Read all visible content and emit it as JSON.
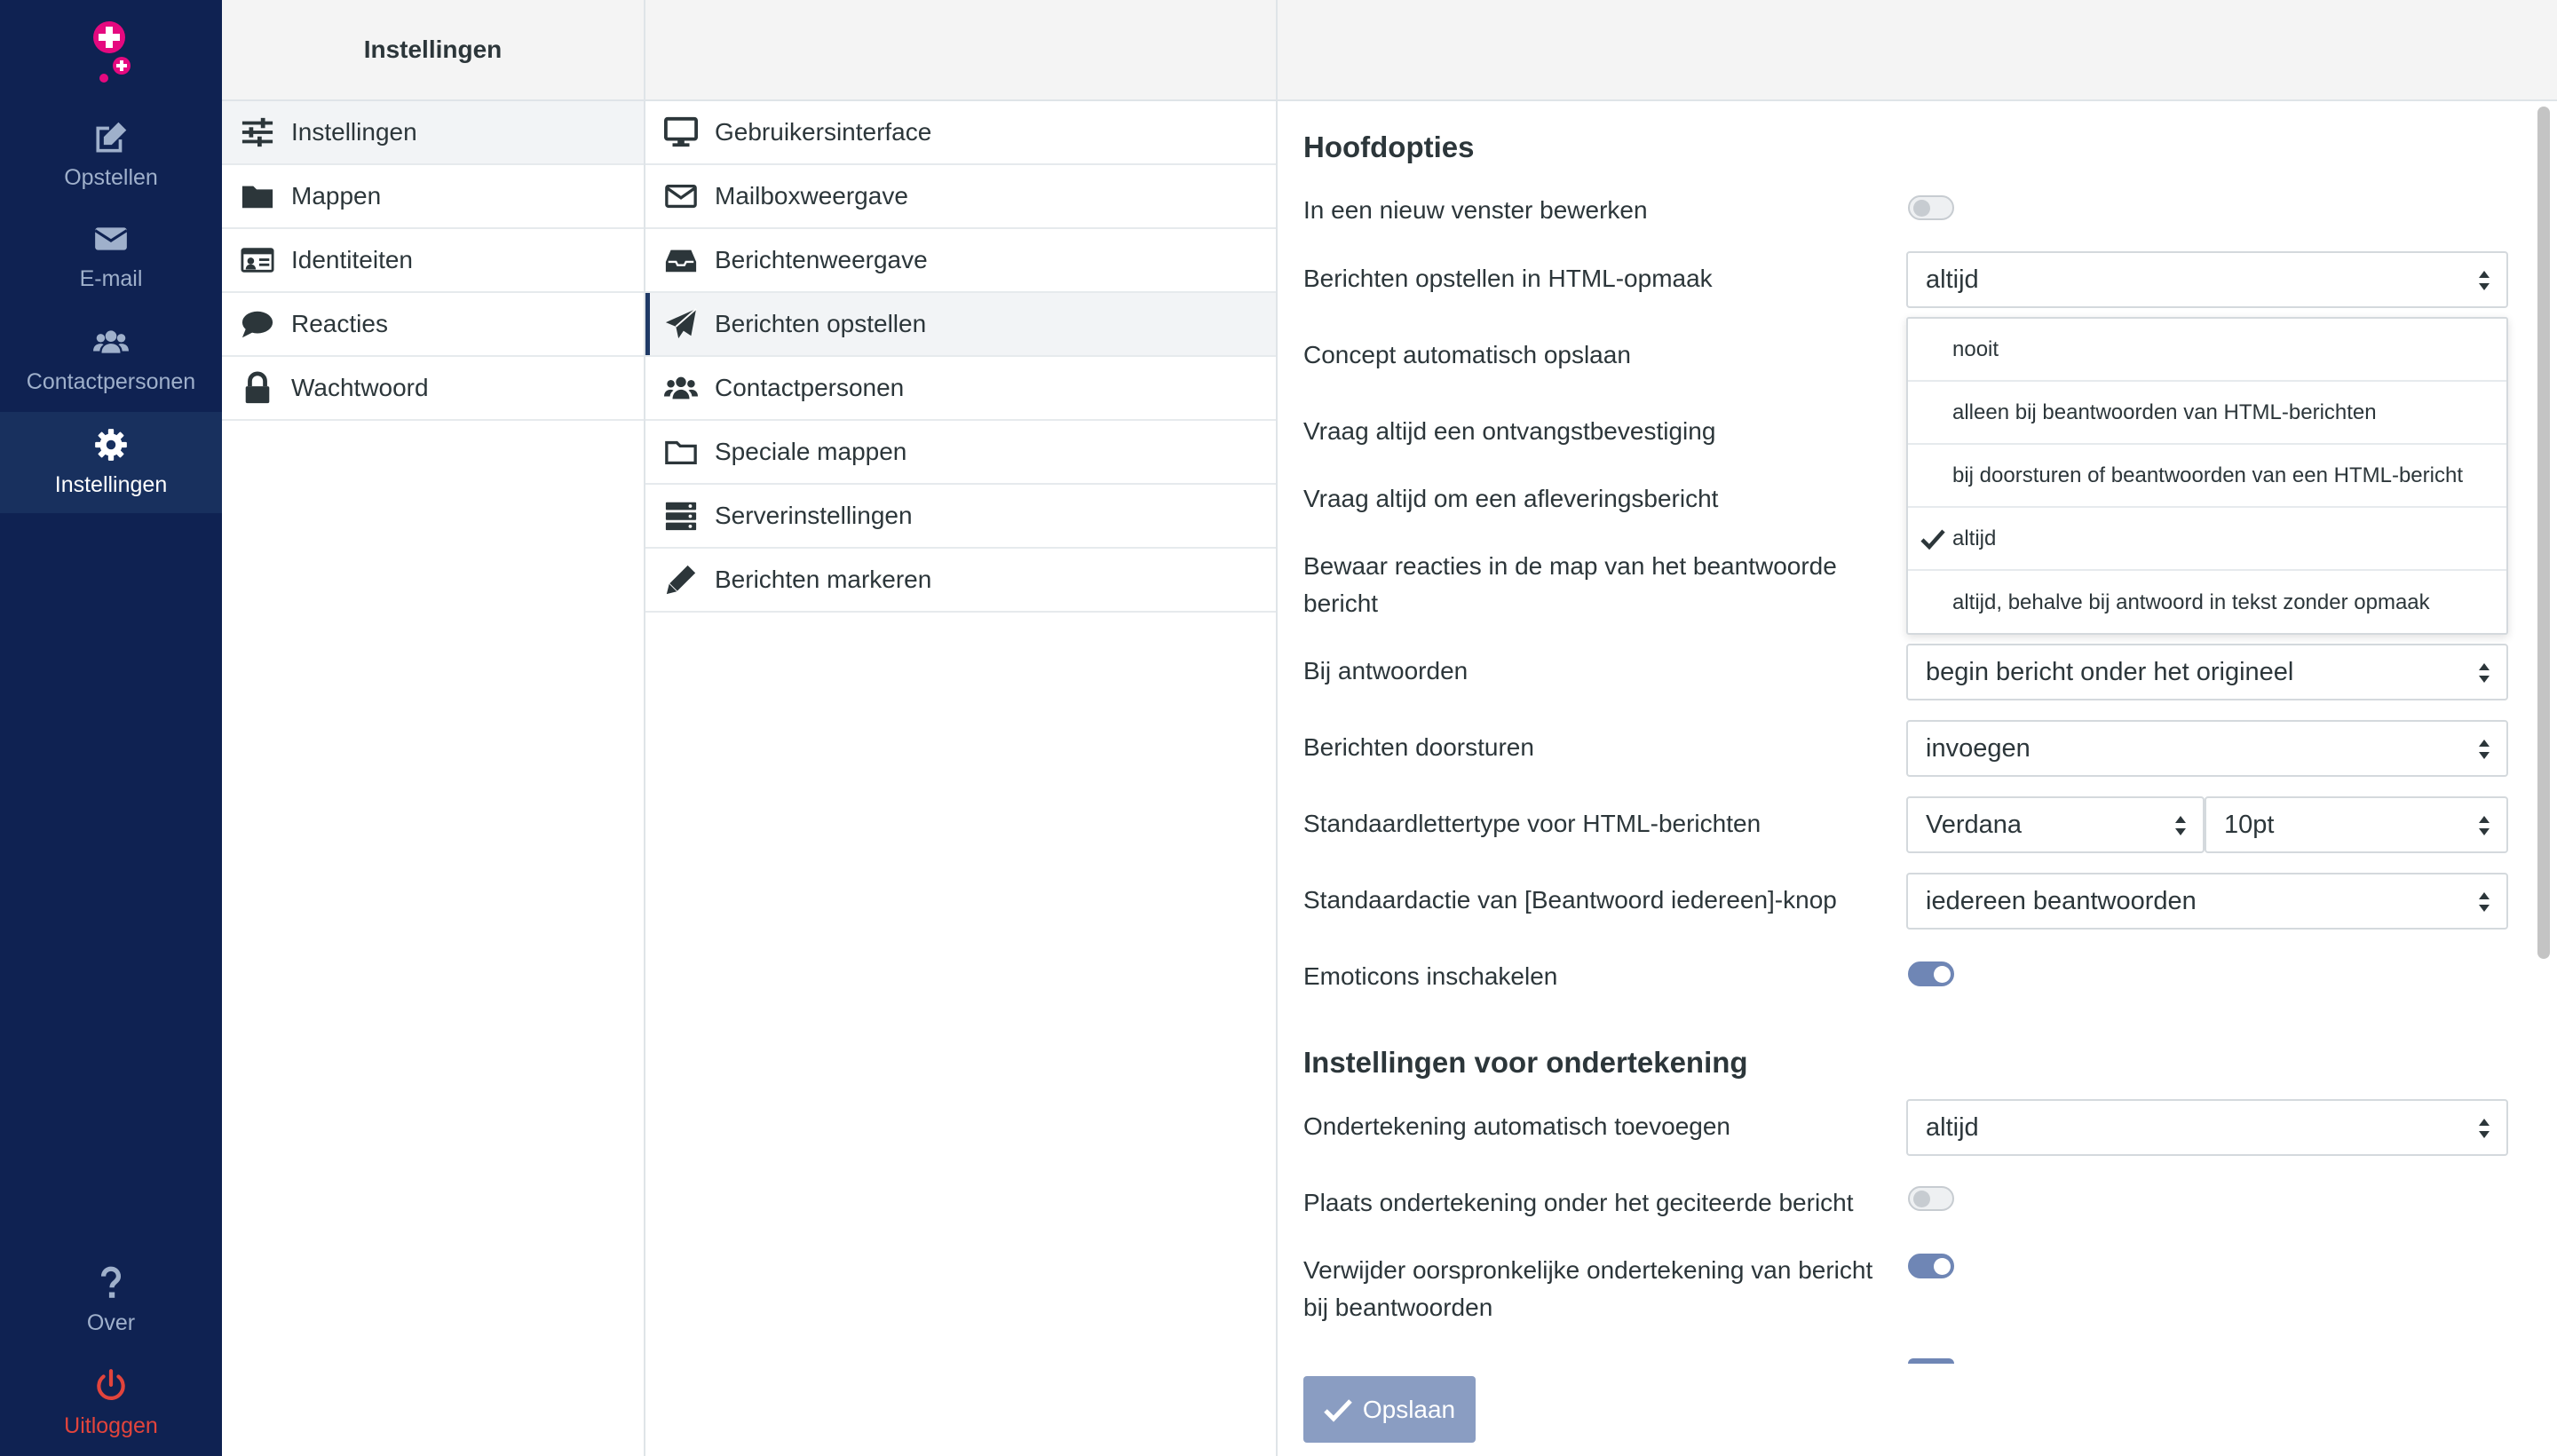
{
  "nav": {
    "compose": "Opstellen",
    "email": "E-mail",
    "contacts": "Contactpersonen",
    "settings": "Instellingen",
    "about": "Over",
    "logout": "Uitloggen"
  },
  "col1": {
    "title": "Instellingen",
    "items": [
      {
        "label": "Instellingen",
        "icon": "sliders-icon"
      },
      {
        "label": "Mappen",
        "icon": "folder-icon"
      },
      {
        "label": "Identiteiten",
        "icon": "id-card-icon"
      },
      {
        "label": "Reacties",
        "icon": "comment-icon"
      },
      {
        "label": "Wachtwoord",
        "icon": "lock-icon"
      }
    ]
  },
  "col2": {
    "items": [
      {
        "label": "Gebruikersinterface",
        "icon": "desktop-icon"
      },
      {
        "label": "Mailboxweergave",
        "icon": "envelope-icon"
      },
      {
        "label": "Berichtenweergave",
        "icon": "inbox-icon"
      },
      {
        "label": "Berichten opstellen",
        "icon": "paper-plane-icon"
      },
      {
        "label": "Contactpersonen",
        "icon": "users-icon"
      },
      {
        "label": "Speciale mappen",
        "icon": "folder-open-icon"
      },
      {
        "label": "Serverinstellingen",
        "icon": "server-icon"
      },
      {
        "label": "Berichten markeren",
        "icon": "pencil-icon"
      }
    ]
  },
  "content": {
    "section1": "Hoofdopties",
    "section2": "Instellingen voor ondertekening",
    "rows": {
      "new_window": "In een nieuw venster bewerken",
      "html_compose": "Berichten opstellen in HTML-opmaak",
      "draft_autosave": "Concept automatisch opslaan",
      "mdn_default": "Vraag altijd een ontvangstbevestiging",
      "dsn_default": "Vraag altijd om een afleveringsbericht",
      "reply_same_folder": "Bewaar reacties in de map van het beantwoorde bericht",
      "reply_mode": "Bij antwoorden",
      "forward_attachment": "Berichten doorsturen",
      "default_font": "Standaardlettertype voor HTML-berichten",
      "reply_all_mode": "Standaardactie van [Beantwoord iedereen]-knop",
      "emoticons": "Emoticons inschakelen",
      "show_sig": "Ondertekening automatisch toevoegen",
      "sig_below": "Plaats ondertekening onder het geciteerde bericht",
      "strip_sig": "Verwijder oorspronkelijke ondertekening van bericht bij beantwoorden"
    },
    "values": {
      "html_compose": "altijd",
      "reply_mode": "begin bericht onder het origineel",
      "forward_attachment": "invoegen",
      "default_font": "Verdana",
      "default_font_size": "10pt",
      "reply_all_mode": "iedereen beantwoorden",
      "show_sig": "altijd"
    },
    "toggles": {
      "new_window": false,
      "emoticons": true,
      "sig_below": false,
      "strip_sig": true
    },
    "dropdown_options": [
      "nooit",
      "alleen bij beantwoorden van HTML-berichten",
      "bij doorsturen of beantwoorden van een HTML-bericht",
      "altijd",
      "altijd, behalve bij antwoord in tekst zonder opmaak"
    ],
    "dropdown_selected": "altijd",
    "save": "Opslaan"
  },
  "colors": {
    "nav_bg": "#0f2252",
    "nav_active": "#18305e",
    "accent": "#6f86b5",
    "logout": "#e2443c",
    "logo": "#e5097f"
  }
}
